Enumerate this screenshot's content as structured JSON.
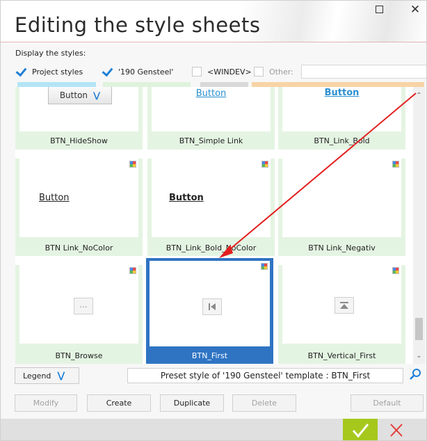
{
  "window": {
    "title": "Editing the style sheets",
    "maximize_label": "",
    "close_label": "✕"
  },
  "filters": {
    "section_label": "Display the styles:",
    "items": [
      {
        "label": "Project styles",
        "checked": true,
        "color": "#b4e5f7"
      },
      {
        "label": "'190 Gensteel'",
        "checked": true,
        "color": "#dff3dc"
      },
      {
        "label": "<WINDEV>",
        "checked": false,
        "color": "#d9d9d9"
      },
      {
        "label": "Other:",
        "checked": false,
        "color": "#f8d4a6"
      }
    ],
    "other_value": ""
  },
  "tiles": [
    {
      "name": "BTN_HideShow",
      "preview": "Button",
      "preview_kind": "dropdown-button",
      "selected": false
    },
    {
      "name": "BTN_Simple Link",
      "preview": "Button",
      "preview_kind": "link",
      "selected": false
    },
    {
      "name": "BTN_Link_Bold",
      "preview": "Button",
      "preview_kind": "bold-link",
      "selected": false
    },
    {
      "name": "BTN Link_NoColor",
      "preview": "Button",
      "preview_kind": "underline-plain",
      "selected": false
    },
    {
      "name": "BTN_Link_Bold_NoColor",
      "preview": "Button",
      "preview_kind": "underline-bold",
      "selected": false
    },
    {
      "name": "BTN Link_Negativ",
      "preview": "",
      "preview_kind": "empty",
      "selected": false
    },
    {
      "name": "BTN_Browse",
      "preview": "...",
      "preview_kind": "browse",
      "selected": false
    },
    {
      "name": "BTN_First",
      "preview": "",
      "preview_kind": "first",
      "selected": true
    },
    {
      "name": "BTN_Vertical_First",
      "preview": "",
      "preview_kind": "vertical-first",
      "selected": false
    }
  ],
  "legend": {
    "label": "Legend"
  },
  "description": "Preset style of '190 Gensteel' template : BTN_First",
  "actions": {
    "modify": "Modify",
    "create": "Create",
    "duplicate": "Duplicate",
    "delete": "Delete",
    "default": "Default"
  },
  "colors": {
    "accent": "#1e7fd6",
    "selected_tile": "#2f74c3",
    "tile_bg": "#e4f4e2",
    "ok_green": "#a6c81d",
    "cancel_red": "#e53935",
    "annotation_arrow": "#e31e1e"
  }
}
